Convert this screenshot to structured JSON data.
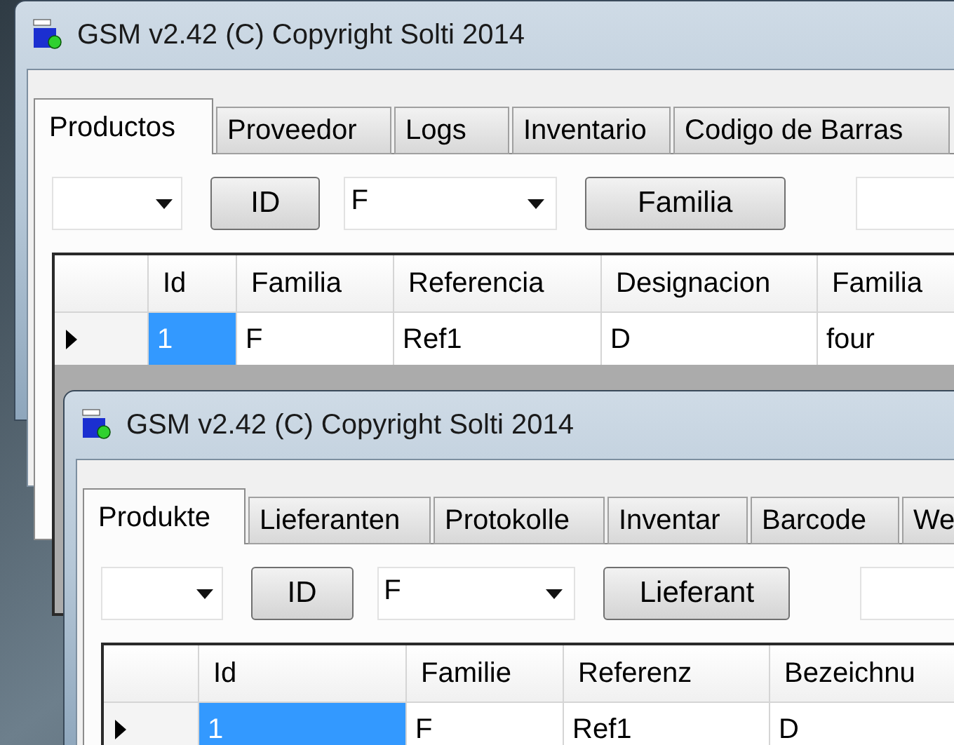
{
  "windows": [
    {
      "title": "GSM v2.42 (C) Copyright Solti 2014",
      "tabs": [
        {
          "label": "Productos",
          "selected": true
        },
        {
          "label": "Proveedor",
          "selected": false
        },
        {
          "label": "Logs",
          "selected": false
        },
        {
          "label": "Inventario",
          "selected": false
        },
        {
          "label": "Codigo de Barras",
          "selected": false
        }
      ],
      "toolbar": {
        "id_button": "ID",
        "combo_2": {
          "value": "F"
        },
        "filter_button": "Familia"
      },
      "columns": [
        "Id",
        "Familia",
        "Referencia",
        "Designacion",
        "Familia"
      ],
      "rows": [
        {
          "current": true,
          "cells": [
            {
              "text": "1",
              "selected": true
            },
            {
              "text": "F",
              "selected": false
            },
            {
              "text": "Ref1",
              "selected": false
            },
            {
              "text": "D",
              "selected": false
            },
            {
              "text": "four",
              "selected": false
            }
          ]
        }
      ]
    },
    {
      "title": "GSM v2.42 (C) Copyright Solti 2014",
      "tabs": [
        {
          "label": "Produkte",
          "selected": true
        },
        {
          "label": "Lieferanten",
          "selected": false
        },
        {
          "label": "Protokolle",
          "selected": false
        },
        {
          "label": "Inventar",
          "selected": false
        },
        {
          "label": "Barcode",
          "selected": false
        },
        {
          "label": "We",
          "selected": false
        }
      ],
      "toolbar": {
        "id_button": "ID",
        "combo_2": {
          "value": "F"
        },
        "filter_button": "Lieferant"
      },
      "columns": [
        "Id",
        "Familie",
        "Referenz",
        "Bezeichnu"
      ],
      "rows": [
        {
          "current": true,
          "cells": [
            {
              "text": "1",
              "selected": true
            },
            {
              "text": "F",
              "selected": false
            },
            {
              "text": "Ref1",
              "selected": false
            },
            {
              "text": "D",
              "selected": false
            }
          ]
        }
      ]
    }
  ]
}
